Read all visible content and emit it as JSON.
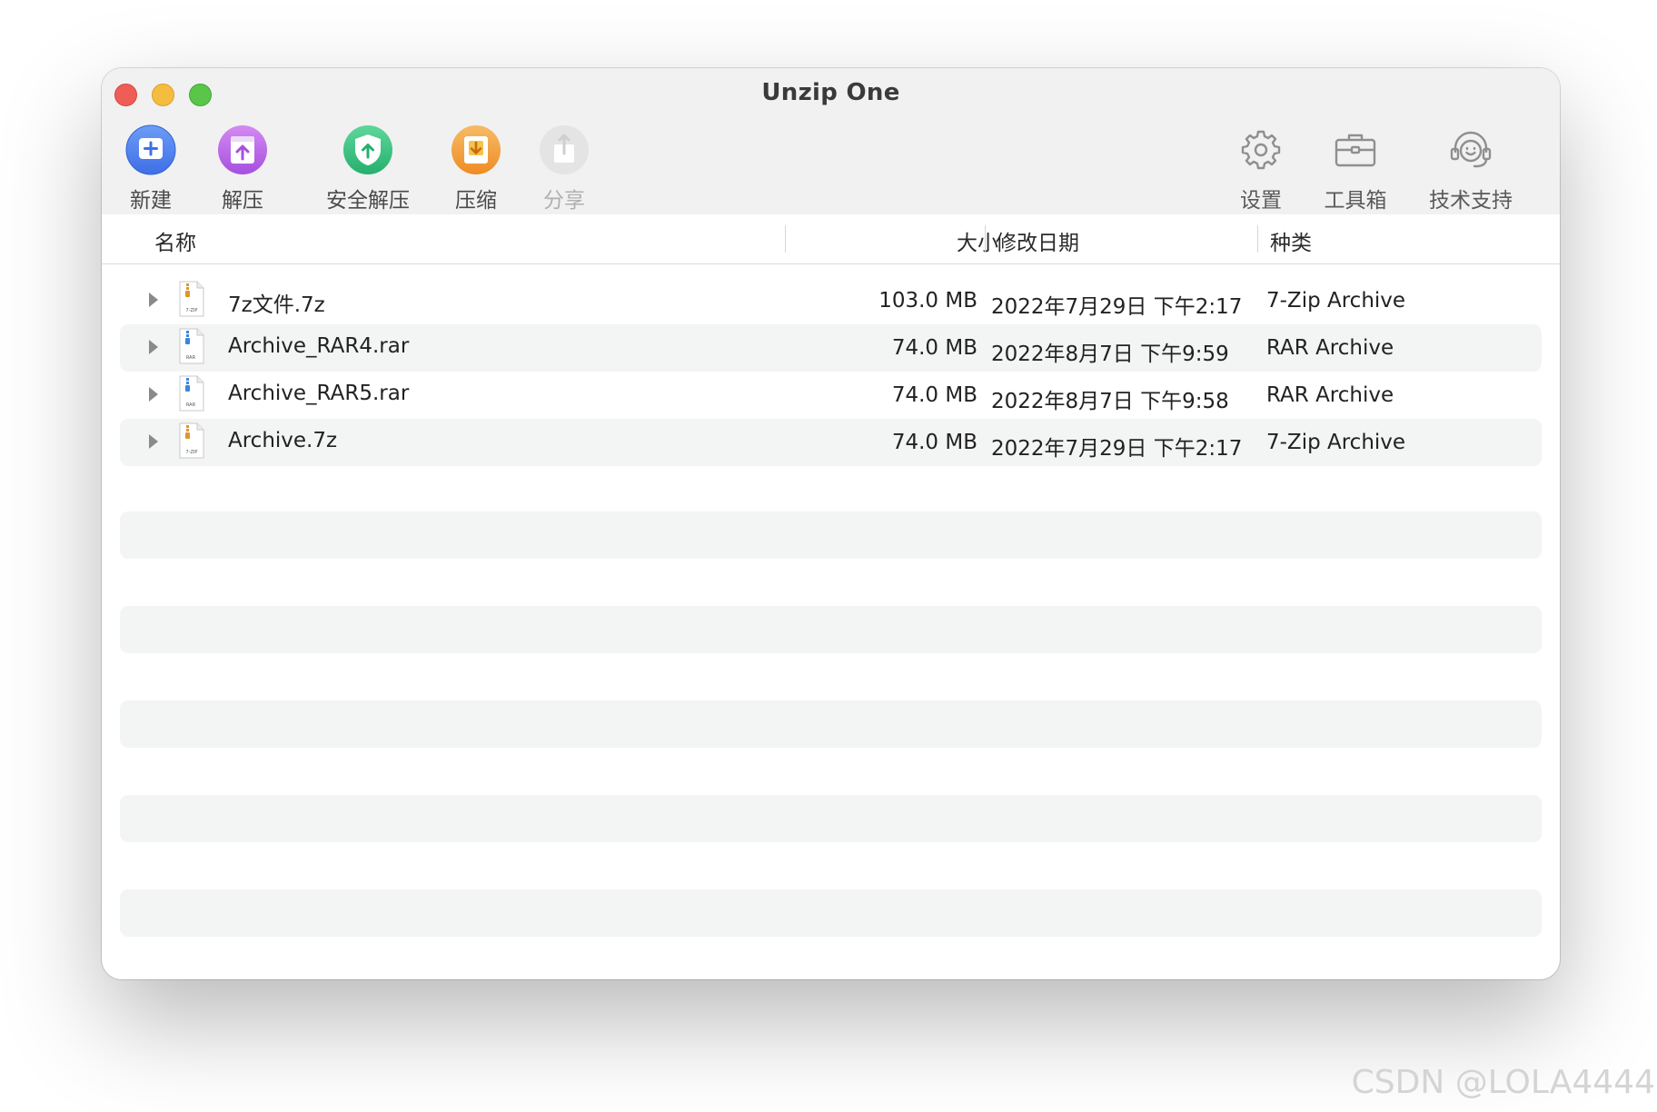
{
  "window": {
    "title": "Unzip One"
  },
  "toolbar": {
    "left": [
      {
        "label": "新建",
        "icon": "new-plus-icon",
        "color": "#4a7df0"
      },
      {
        "label": "解压",
        "icon": "extract-upload-icon",
        "color": "#b35ce6"
      },
      {
        "label": "安全解压",
        "icon": "secure-extract-shield-icon",
        "color": "#2ebd78"
      },
      {
        "label": "压缩",
        "icon": "compress-download-icon",
        "color": "#f0962e"
      },
      {
        "label": "分享",
        "icon": "share-icon",
        "color": "#d9d9d9",
        "disabled": true
      }
    ],
    "right": [
      {
        "label": "设置",
        "icon": "gear-icon"
      },
      {
        "label": "工具箱",
        "icon": "toolbox-icon"
      },
      {
        "label": "技术支持",
        "icon": "support-headset-icon"
      }
    ]
  },
  "columns": {
    "name": "名称",
    "size": "大小",
    "modified": "修改日期",
    "kind": "种类"
  },
  "files": [
    {
      "name": "7z文件.7z",
      "size": "103.0 MB",
      "modified": "2022年7月29日 下午2:17",
      "kind": "7-Zip Archive",
      "icon": "7z-archive-icon",
      "badge": "7-ZIP"
    },
    {
      "name": "Archive_RAR4.rar",
      "size": "74.0 MB",
      "modified": "2022年8月7日 下午9:59",
      "kind": "RAR Archive",
      "icon": "rar-archive-icon",
      "badge": "RAR"
    },
    {
      "name": "Archive_RAR5.rar",
      "size": "74.0 MB",
      "modified": "2022年8月7日 下午9:58",
      "kind": "RAR Archive",
      "icon": "rar-archive-icon",
      "badge": "RAR"
    },
    {
      "name": "Archive.7z",
      "size": "74.0 MB",
      "modified": "2022年7月29日 下午2:17",
      "kind": "7-Zip Archive",
      "icon": "7z-archive-icon",
      "badge": "7-ZIP"
    }
  ],
  "watermark": "CSDN @LOLA4444"
}
